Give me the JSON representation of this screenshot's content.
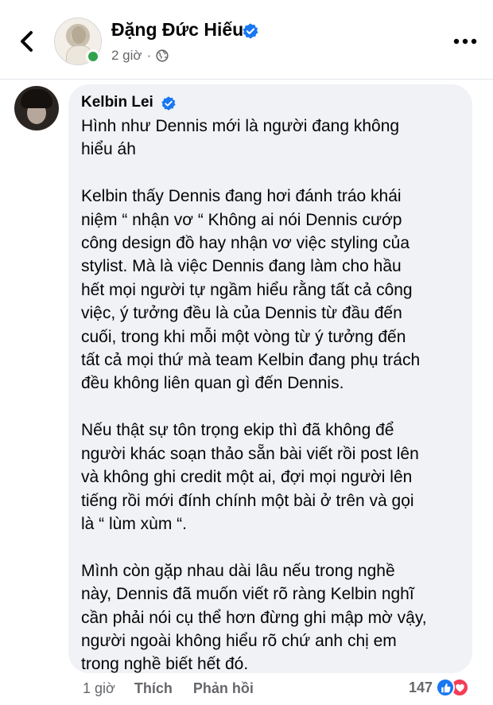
{
  "header": {
    "author_name": "Đặng Đức Hiếu",
    "post_time": "2 giờ",
    "back_icon": "chevron-left-icon",
    "more_icon": "more-horizontal-icon",
    "audience_icon": "globe-icon"
  },
  "comment": {
    "commenter_name": "Kelbin Lei",
    "text": "Hình như Dennis mới là người đang không\nhiểu áh\n\nKelbin thấy Dennis đang hơi đánh tráo khái\nniệm “ nhận vơ “ Không ai nói Dennis cướp\ncông design đồ hay nhận vơ việc styling của\nstylist. Mà là việc Dennis đang làm cho hầu\nhết mọi người tự ngầm hiểu rằng tất cả công\nviệc, ý tưởng đều là của Dennis từ đầu đến\ncuối, trong khi mỗi một vòng từ ý tưởng đến\ntất cả mọi thứ mà team Kelbin đang phụ trách\nđều không liên quan gì đến Dennis.\n\nNếu thật sự tôn trọng ekip thì đã không để\nngười khác soạn thảo sẵn bài viết rồi post lên\nvà không ghi credit một ai, đợi mọi người lên\ntiếng rồi mới đính chính một bài ở trên và gọi\nlà “ lùm xùm “.\n\nMình còn gặp nhau dài lâu nếu trong nghề\nnày, Dennis đã muốn viết rõ ràng Kelbin nghĩ\ncần phải nói cụ thể hơn đừng ghi mập mờ vậy,\nngười ngoài không hiểu rõ chứ anh chị em\ntrong nghề biết hết đó.",
    "time": "1 giờ",
    "like_label": "Thích",
    "reply_label": "Phản hồi",
    "reaction_count": "147",
    "reaction_icons": [
      "like-icon",
      "love-icon"
    ]
  },
  "colors": {
    "verified": "#1877f2",
    "online": "#31a24c",
    "bubble": "#f0f2f5",
    "muted_text": "#65676b",
    "love": "#f33e58"
  }
}
